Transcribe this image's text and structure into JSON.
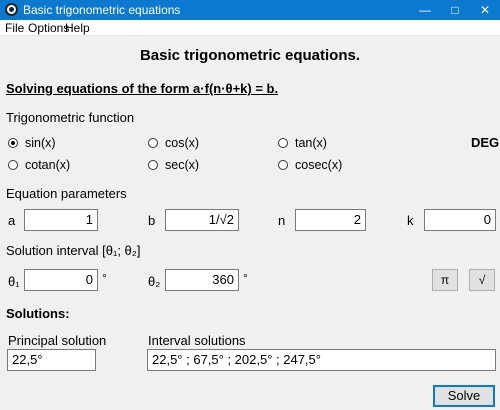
{
  "window": {
    "title": "Basic trigonometric equations"
  },
  "menu": [
    "File",
    "Options",
    "Help"
  ],
  "heading": "Basic trigonometric equations.",
  "subheading": "Solving equations of the form a·f(n·θ+k) = b.",
  "trig": {
    "label": "Trigonometric function",
    "options": [
      "sin(x)",
      "cos(x)",
      "tan(x)",
      "cotan(x)",
      "sec(x)",
      "cosec(x)"
    ],
    "selected": "sin(x)",
    "angle_mode": "DEG"
  },
  "params": {
    "label": "Equation parameters",
    "a_label": "a",
    "a_value": "1",
    "b_label": "b",
    "b_value": "1/√2",
    "n_label": "n",
    "n_value": "2",
    "k_label": "k",
    "k_value": "0"
  },
  "interval": {
    "label": "Solution interval [θ₁; θ₂]",
    "t1_label": "θ₁",
    "t1_value": "0",
    "t1_unit": "°",
    "t2_label": "θ₂",
    "t2_value": "360",
    "t2_unit": "°",
    "pi_button": "π",
    "sqrt_button": "√"
  },
  "solutions": {
    "label": "Solutions:",
    "principal_label": "Principal solution",
    "principal_value": "22,5°",
    "interval_label": "Interval solutions",
    "interval_value": "22,5° ; 67,5° ; 202,5° ; 247,5°"
  },
  "solve_button": "Solve"
}
